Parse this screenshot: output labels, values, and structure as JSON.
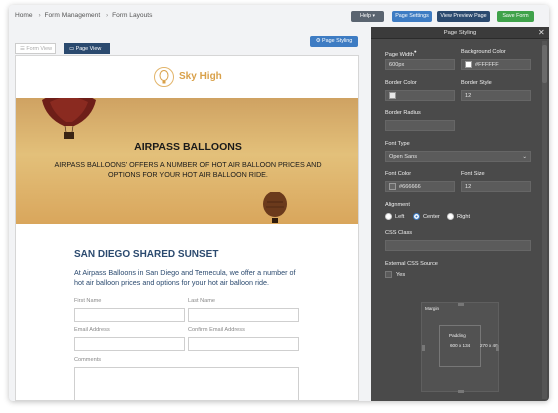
{
  "breadcrumb": {
    "home": "Home",
    "form_management": "Form Management",
    "form_layouts": "Form Layouts",
    "separator": "›"
  },
  "topbar": {
    "help": "Help",
    "page_settings": "Page Settings",
    "view_preview": "View Preview Page",
    "save": "Save Form"
  },
  "tabs": {
    "form_view": "Form View",
    "page_view": "Page View"
  },
  "page_styling_button": "Page Styling",
  "form": {
    "logo_text": "Sky High",
    "hero_title": "AIRPASS BALLOONS",
    "hero_subtitle": "AIRPASS BALLOONS' OFFERS A NUMBER OF HOT AIR BALLOON PRICES AND OPTIONS FOR YOUR HOT AIR BALLOON RIDE.",
    "section_title": "SAN DIEGO SHARED SUNSET",
    "intro": "At Airpass Balloons in San Diego and Temecula, we offer a number of hot air balloon prices and options for your hot air balloon ride.",
    "fields": {
      "first_name": "First Name",
      "last_name": "Last Name",
      "email": "Email Address",
      "confirm_email": "Confirm Email Address",
      "comments": "Comments"
    }
  },
  "panel": {
    "title": "Page Styling",
    "page_width_label": "Page Width",
    "page_width_value": "600px",
    "background_color_label": "Background Color",
    "background_color_value": "#FFFFFF",
    "border_color_label": "Border Color",
    "border_style_label": "Border Style",
    "border_style_value": "12",
    "border_radius_label": "Border Radius",
    "font_type_label": "Font Type",
    "font_type_value": "Open Sans",
    "font_color_label": "Font Color",
    "font_color_value": "#666666",
    "font_size_label": "Font Size",
    "font_size_value": "12",
    "alignment_label": "Alignment",
    "alignment_options": {
      "left": "Left",
      "center": "Center",
      "right": "Right"
    },
    "alignment_selected": "Center",
    "css_class_label": "CSS Class",
    "external_css_label": "External CSS Source",
    "external_css_option": "Yes",
    "box_model": {
      "margin": "Margin",
      "padding": "Padding",
      "inner_size": "600 x 134",
      "outer_size": "270 x 40"
    }
  },
  "colors": {
    "accent": "#3e7cc3",
    "navy": "#2b4a6f",
    "save_green": "#3fa24a",
    "panel_bg": "#4a4a4a"
  }
}
